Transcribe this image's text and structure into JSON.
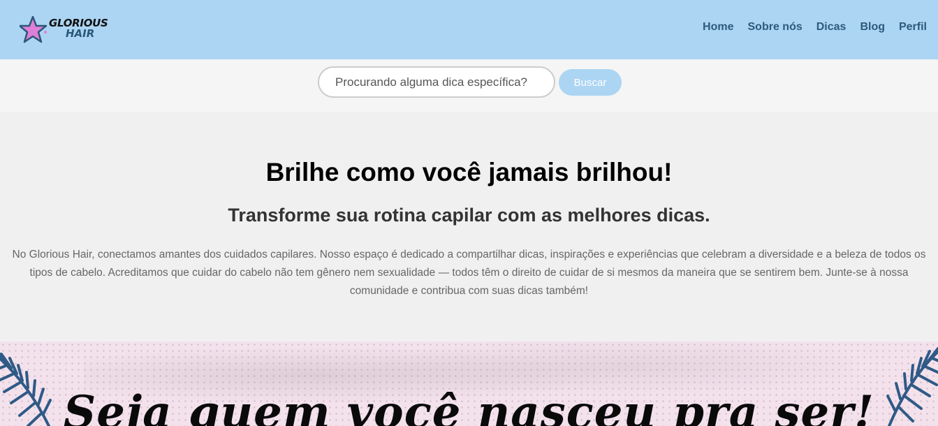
{
  "header": {
    "logo": {
      "line1": "GLORIOUS",
      "line2": "HAIR",
      "icon": "star-icon"
    },
    "nav": [
      {
        "label": "Home"
      },
      {
        "label": "Sobre nós"
      },
      {
        "label": "Dicas"
      },
      {
        "label": "Blog"
      },
      {
        "label": "Perfil"
      }
    ]
  },
  "search": {
    "placeholder": "Procurando alguma dica específica?",
    "button_label": "Buscar"
  },
  "hero": {
    "title": "Brilhe como você jamais brilhou!",
    "subtitle": "Transforme sua rotina capilar com as melhores dicas.",
    "text": "No Glorious Hair, conectamos amantes dos cuidados capilares. Nosso espaço é dedicado a compartilhar dicas, inspirações e experiências que celebram a diversidade e a beleza de todos os tipos de cabelo. Acreditamos que cuidar do cabelo não tem gênero nem sexualidade — todos têm o direito de cuidar de si mesmos da maneira que se sentirem bem. Junte-se à nossa comunidade e contribua com suas dicas também!"
  },
  "banner": {
    "title": "Seja quem você nasceu pra ser!",
    "decoration_icon": "palm-leaf-icon"
  },
  "colors": {
    "header_bg": "#acd5f3",
    "nav_text": "#2e5a7c",
    "banner_bg": "#f3e2ec",
    "leaf": "#2f5a86"
  }
}
